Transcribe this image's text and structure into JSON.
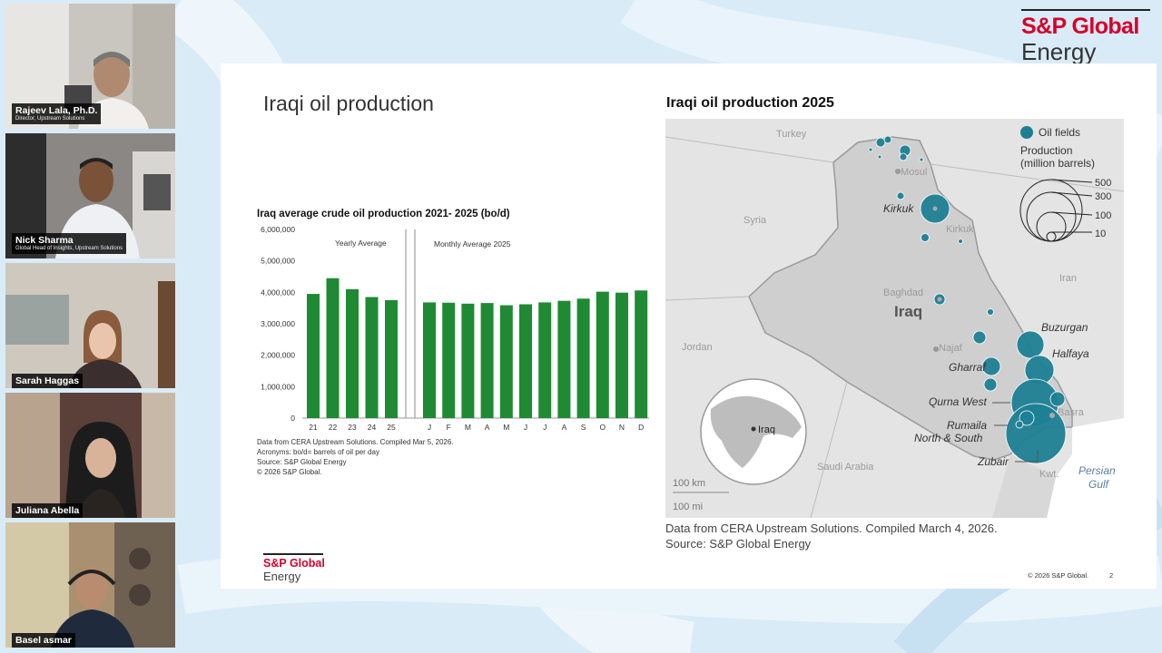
{
  "participants": [
    {
      "name": "Rajeev Lala, Ph.D.",
      "role": "Director, Upstream Solutions"
    },
    {
      "name": "Nick Sharma",
      "role": "Global Head of Insights, Upstream Solutions"
    },
    {
      "name": "Sarah Haggas",
      "role": ""
    },
    {
      "name": "Juliana Abella",
      "role": ""
    },
    {
      "name": "Basel asmar",
      "role": ""
    }
  ],
  "brand": {
    "line1": "S&P Global",
    "line2": "Energy"
  },
  "slide": {
    "title": "Iraqi oil production",
    "footer_copyright": "© 2026 S&P Global.",
    "page_number": "2",
    "logo": {
      "line1": "S&P Global",
      "line2": "Energy"
    }
  },
  "chart": {
    "title": "Iraq average crude oil production 2021- 2025 (bo/d)",
    "notes": [
      "Data from CERA Upstream Solutions. Compiled Mar 5, 2026.",
      "Acronyms: bo/d= barrels of oil per day",
      "Source: S&P Global Energy",
      "© 2026 S&P Global."
    ]
  },
  "chart_data": {
    "type": "bar",
    "title": "Iraq average crude oil production 2021- 2025 (bo/d)",
    "ylim": [
      0,
      6000000
    ],
    "yticks": [
      "6,000,000",
      "5,000,000",
      "4,000,000",
      "3,000,000",
      "2,000,000",
      "1,000,000",
      "0"
    ],
    "ytick_values": [
      6000000,
      5000000,
      4000000,
      3000000,
      2000000,
      1000000,
      0
    ],
    "bar_color": "#1f8a33",
    "groups": [
      {
        "label": "Yearly Average",
        "categories": [
          "21",
          "22",
          "23",
          "24",
          "25"
        ],
        "values": [
          3950000,
          4450000,
          4100000,
          3850000,
          3750000
        ]
      },
      {
        "label": "Monthly Average 2025",
        "categories": [
          "J",
          "F",
          "M",
          "A",
          "M",
          "J",
          "J",
          "A",
          "S",
          "O",
          "N",
          "D"
        ],
        "values": [
          3680000,
          3670000,
          3640000,
          3660000,
          3590000,
          3620000,
          3680000,
          3730000,
          3800000,
          4020000,
          3990000,
          4060000
        ]
      }
    ],
    "grid": false
  },
  "map": {
    "title": "Iraqi oil production 2025",
    "legend": {
      "fields_label": "Oil fields",
      "production_label": "Production",
      "production_unit": "(million barrels)",
      "sizes": [
        "500",
        "300",
        "100",
        "10"
      ]
    },
    "country_labels": [
      "Turkey",
      "Syria",
      "Iran",
      "Jordan",
      "Saudi Arabia",
      "Kwt."
    ],
    "city_labels": [
      "Mosul",
      "Kirkuk",
      "Baghdad",
      "Najaf",
      "Basra"
    ],
    "iraq_label": "Iraq",
    "field_labels": [
      "Kirkuk",
      "Buzurgan",
      "Halfaya",
      "Gharraf",
      "Qurna West",
      "Rumaila",
      "North & South",
      "Zubair"
    ],
    "sea_label": [
      "Persian",
      "Gulf"
    ],
    "inset_label": "Iraq",
    "scale": [
      "100 km",
      "100 mi"
    ],
    "field_color": "#1e7f94",
    "notes": [
      "Data from CERA Upstream Solutions. Compiled March 4, 2026.",
      "Source: S&P Global Energy"
    ]
  }
}
